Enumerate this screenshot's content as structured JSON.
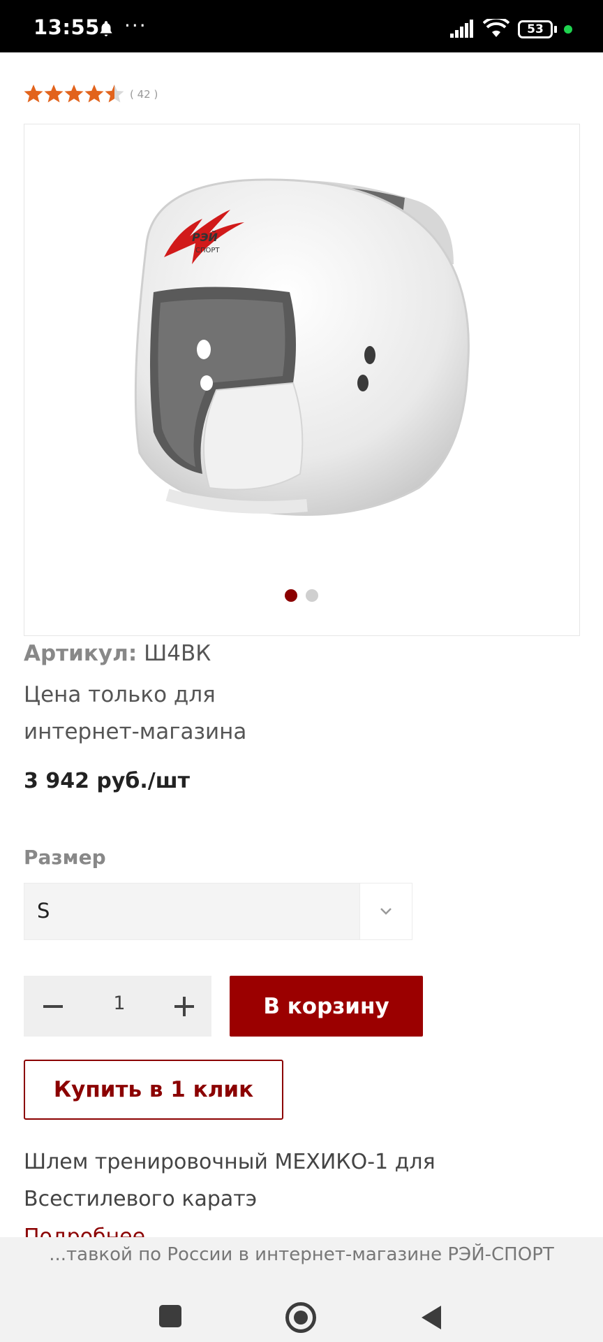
{
  "status_bar": {
    "time": "13:55",
    "more": "···",
    "battery": "53"
  },
  "rating": {
    "value": 4.5,
    "count_text": "( 42 )"
  },
  "gallery": {
    "image_logo_text": "РЭЙ",
    "image_logo_subtext": "СПОРТ",
    "active_slide": 1,
    "slides": 2
  },
  "product": {
    "sku_label": "Артикул:",
    "sku_value": "Ш4ВК",
    "price_note": "Цена только для интернет-магазина",
    "price": "3 942 руб./шт",
    "size_label": "Размер",
    "size_selected": "S",
    "quantity": "1",
    "add_to_cart": "В корзину",
    "buy_one_click": "Купить в 1 клик",
    "description": "Шлем тренировочный МЕХИКО-1 для Всестилевого каратэ",
    "more_link": "Подробнее"
  },
  "footer": {
    "text": "...тавкой по России в интернет-магазине РЭЙ-СПОРТ"
  },
  "colors": {
    "accent": "#9b0000",
    "star": "#e2631c"
  }
}
